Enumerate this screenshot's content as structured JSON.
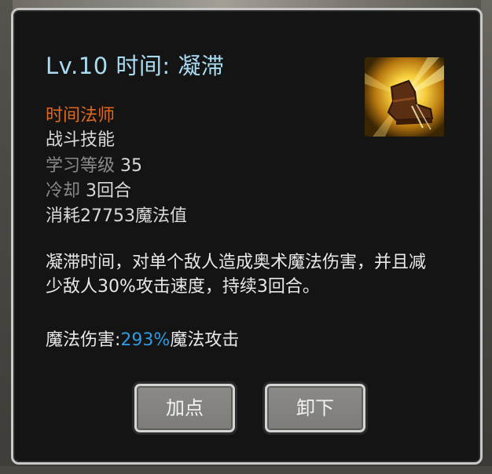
{
  "skill": {
    "title": "Lv.10 时间: 凝滞",
    "class_name": "时间法师",
    "type": "战斗技能",
    "learn_level_label": "学习等级",
    "learn_level_value": "35",
    "cooldown_label": "冷却",
    "cooldown_value": "3回合",
    "cost": "消耗27753魔法值",
    "description": "凝滞时间，对单个敌人造成奥术魔法伤害，并且减少敌人30%攻击速度，持续3回合。",
    "damage_label": "魔法伤害:",
    "damage_percent": "293%",
    "damage_suffix": "魔法攻击",
    "icon": "golden-boot-icon"
  },
  "buttons": {
    "add_point": "加点",
    "unequip": "卸下"
  },
  "colors": {
    "title": "#a9dcf2",
    "class_name": "#e2681f",
    "highlight": "#2e9be0",
    "panel_bg": "#141414",
    "border": "#c9c9c9"
  }
}
